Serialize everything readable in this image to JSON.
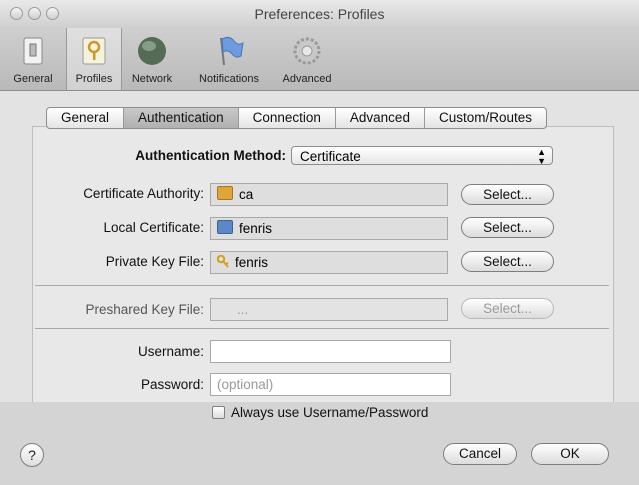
{
  "window": {
    "title": "Preferences: Profiles"
  },
  "toolbar": {
    "items": [
      {
        "label": "General",
        "icon": "switch-icon"
      },
      {
        "label": "Profiles",
        "icon": "profile-key-icon",
        "selected": true
      },
      {
        "label": "Network",
        "icon": "network-globe-icon"
      },
      {
        "label": "Notifications",
        "icon": "flag-icon"
      },
      {
        "label": "Advanced",
        "icon": "gear-icon"
      }
    ]
  },
  "tabs": {
    "items": [
      {
        "label": "General"
      },
      {
        "label": "Authentication",
        "active": true
      },
      {
        "label": "Connection"
      },
      {
        "label": "Advanced"
      },
      {
        "label": "Custom/Routes"
      }
    ]
  },
  "auth": {
    "method_label": "Authentication Method:",
    "method_value": "Certificate",
    "rows": [
      {
        "label": "Certificate Authority:",
        "value": "ca",
        "icon": "certificate-icon",
        "button": "Select..."
      },
      {
        "label": "Local Certificate:",
        "value": "fenris",
        "icon": "certificate-icon",
        "button": "Select..."
      },
      {
        "label": "Private Key File:",
        "value": "fenris",
        "icon": "key-icon",
        "button": "Select..."
      }
    ],
    "preshared_label": "Preshared Key File:",
    "preshared_value": "...",
    "preshared_button": "Select...",
    "username_label": "Username:",
    "username_value": "",
    "password_label": "Password:",
    "password_placeholder": "(optional)",
    "always_use_label": "Always use Username/Password"
  },
  "footer": {
    "help": "?",
    "cancel": "Cancel",
    "ok": "OK"
  },
  "colors": {
    "ok_button": "#ffffff",
    "ca_icon": "#e0a53a",
    "cert_icon": "#5c88c8",
    "key_icon": "#d4a020"
  }
}
